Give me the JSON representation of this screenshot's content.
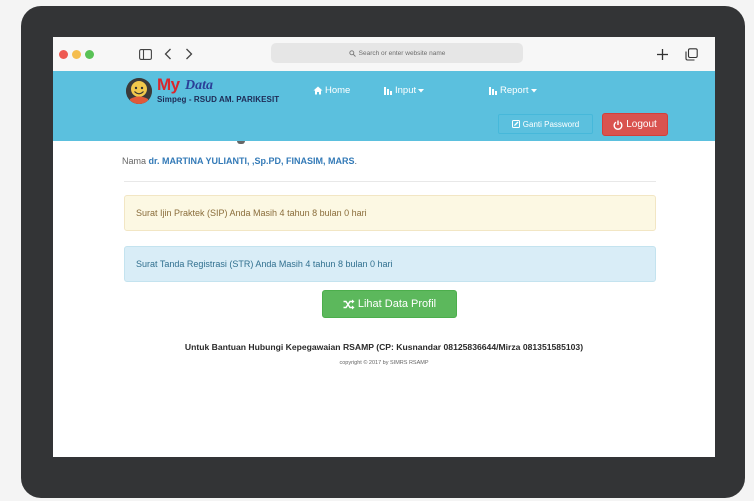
{
  "browser": {
    "address_placeholder": "Search or enter website name"
  },
  "app": {
    "brand_my": "My",
    "brand_data": "Data",
    "brand_subtitle": "Simpeg - RSUD AM. PARIKESIT",
    "colors": {
      "navbar": "#5bc0de",
      "logout": "#d9534f",
      "success": "#5cb85c"
    }
  },
  "nav": {
    "home": "Home",
    "input": "Input",
    "report": "Report",
    "ganti_password": "Ganti Password",
    "logout": "Logout"
  },
  "profile": {
    "nama_label": "Nama",
    "nama_value": "dr. MARTINA YULIANTI, ,Sp.PD, FINASIM, MARS",
    "nama_suffix": "."
  },
  "alerts": {
    "sip": "Surat Ijin Praktek (SIP) Anda Masih 4 tahun 8 bulan 0 hari",
    "str": "Surat Tanda Registrasi (STR) Anda Masih 4 tahun 8 bulan 0 hari"
  },
  "actions": {
    "lihat_profil": "Lihat Data Profil"
  },
  "footer": {
    "bantuan": "Untuk Bantuan Hubungi Kepegawaian RSAMP (CP: Kusnandar 08125836644/Mirza 081351585103)",
    "copyright": "copyright © 2017 by SIMRS RSAMP"
  }
}
